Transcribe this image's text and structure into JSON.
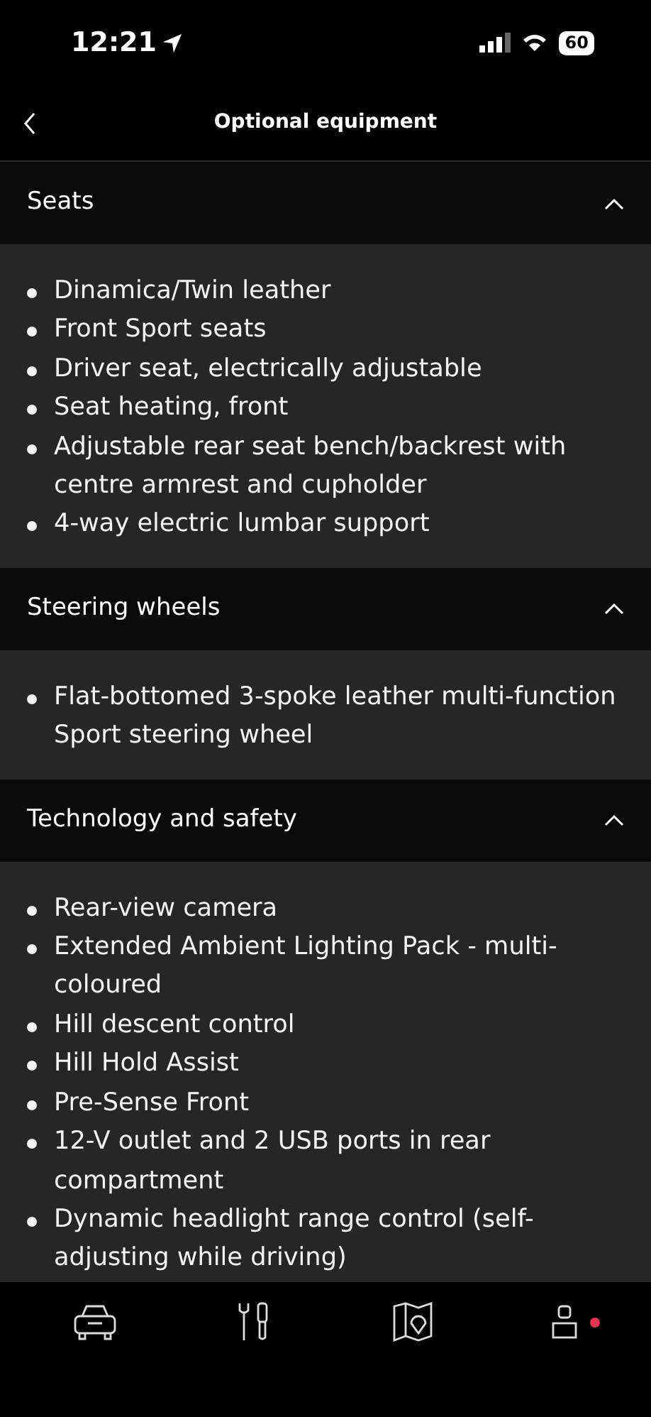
{
  "status_bar": {
    "time": "12:21",
    "battery": "60"
  },
  "header": {
    "title": "Optional equipment"
  },
  "sections": [
    {
      "title": "Seats",
      "expanded": true,
      "items": [
        "Dinamica/Twin leather",
        "Front Sport seats",
        "Driver seat, electrically adjustable",
        "Seat heating, front",
        "Adjustable rear seat bench/backrest with centre armrest and cupholder",
        "4-way electric lumbar support"
      ]
    },
    {
      "title": "Steering wheels",
      "expanded": true,
      "items": [
        "Flat-bottomed 3-spoke leather multi-function Sport steering wheel"
      ]
    },
    {
      "title": "Technology and safety",
      "expanded": true,
      "items": [
        "Rear-view camera",
        "Extended Ambient Lighting Pack - multi-coloured",
        "Hill descent control",
        "Hill Hold Assist",
        "Pre-Sense Front",
        "12-V outlet and 2 USB ports in rear compartment",
        "Dynamic headlight range control (self-adjusting while driving)"
      ]
    }
  ],
  "tab_bar": [
    {
      "kind": "car",
      "notification": false
    },
    {
      "kind": "tools",
      "notification": false
    },
    {
      "kind": "map",
      "notification": false
    },
    {
      "kind": "profile",
      "notification": true
    }
  ]
}
